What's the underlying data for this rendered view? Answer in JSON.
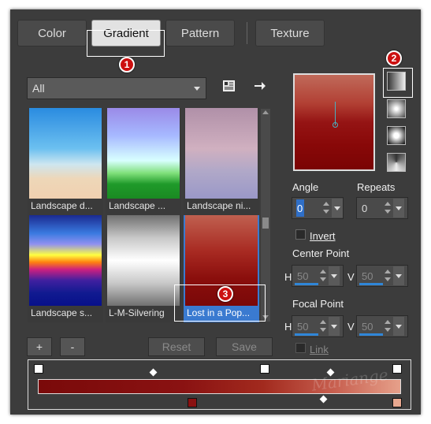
{
  "tabs": [
    {
      "label": "Color"
    },
    {
      "label": "Gradient"
    },
    {
      "label": "Pattern"
    },
    {
      "label": "Texture"
    }
  ],
  "category": {
    "selected": "All"
  },
  "gradients": [
    {
      "label": "Landscape d..."
    },
    {
      "label": "Landscape ..."
    },
    {
      "label": "Landscape ni..."
    },
    {
      "label": "Landscape s..."
    },
    {
      "label": "L-M-Silvering"
    },
    {
      "label": "Lost in a Pop..."
    }
  ],
  "buttons": {
    "add": "+",
    "remove": "-",
    "reset": "Reset",
    "save": "Save"
  },
  "angle": {
    "label": "Angle",
    "value": "0"
  },
  "repeats": {
    "label": "Repeats",
    "value": "0"
  },
  "invert": {
    "label": "Invert",
    "checked": false
  },
  "center_point": {
    "label": "Center Point",
    "h_label": "H",
    "h_value": "50",
    "v_label": "V",
    "v_value": "50"
  },
  "focal_point": {
    "label": "Focal Point",
    "h_label": "H",
    "h_value": "50",
    "v_label": "V",
    "v_value": "50"
  },
  "link": {
    "label": "Link",
    "checked": false
  },
  "annotations": {
    "one": "1",
    "two": "2",
    "three": "3"
  },
  "watermark": "Mariange",
  "colors": {
    "gradient_start": "#7a0a0a",
    "gradient_end": "#e6a08a",
    "accent": "#2f86d8",
    "selection": "#3a7ad0"
  }
}
